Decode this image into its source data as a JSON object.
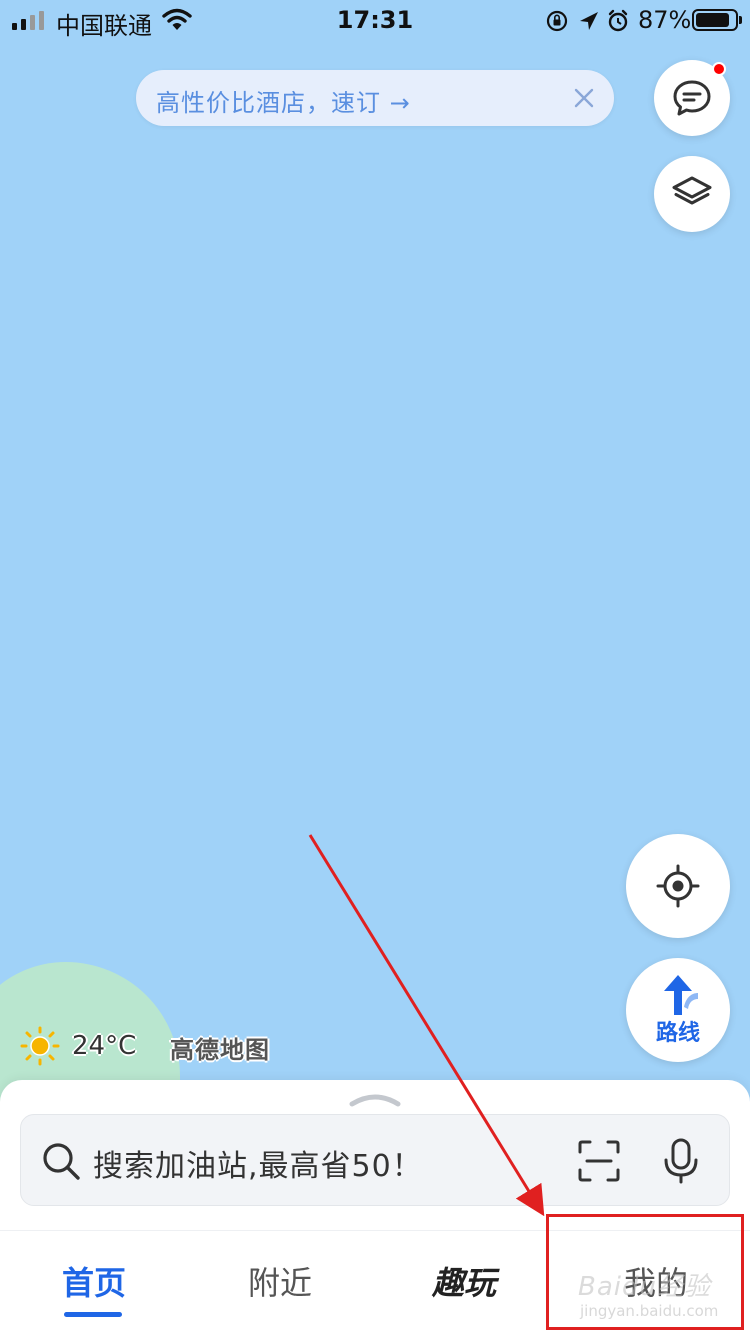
{
  "status_bar": {
    "carrier": "中国联通",
    "time": "17:31",
    "battery_percent_text": "87%",
    "battery_level": 0.87,
    "icons": [
      "signal-icon",
      "wifi-icon",
      "orientation-lock-icon",
      "location-arrow-icon",
      "alarm-icon",
      "battery-icon"
    ]
  },
  "promo": {
    "text": "高性价比酒店，速订 →",
    "close_icon": "close-icon"
  },
  "map_controls": {
    "message_icon": "message-icon",
    "layers_icon": "layers-icon",
    "locate_icon": "locate-icon",
    "route_icon": "route-icon",
    "route_label": "路线"
  },
  "weather": {
    "icon": "sun-icon",
    "temperature": "24°C"
  },
  "brand": {
    "logo_text": "高德地图"
  },
  "search": {
    "placeholder": "搜索加油站,最高省50！",
    "search_icon": "search-icon",
    "scan_icon": "scan-icon",
    "mic_icon": "microphone-icon"
  },
  "tabs": [
    {
      "label": "首页",
      "active": true
    },
    {
      "label": "附近",
      "active": false
    },
    {
      "label": "趣玩",
      "active": false
    },
    {
      "label": "我的",
      "active": false
    }
  ],
  "watermark": {
    "text": "Baidu经验",
    "sub": "jingyan.baidu.com"
  },
  "colors": {
    "map_water": "#a0d2f8",
    "land": "#b9e6cf",
    "accent": "#1f66e6",
    "annotation": "#e02020"
  }
}
